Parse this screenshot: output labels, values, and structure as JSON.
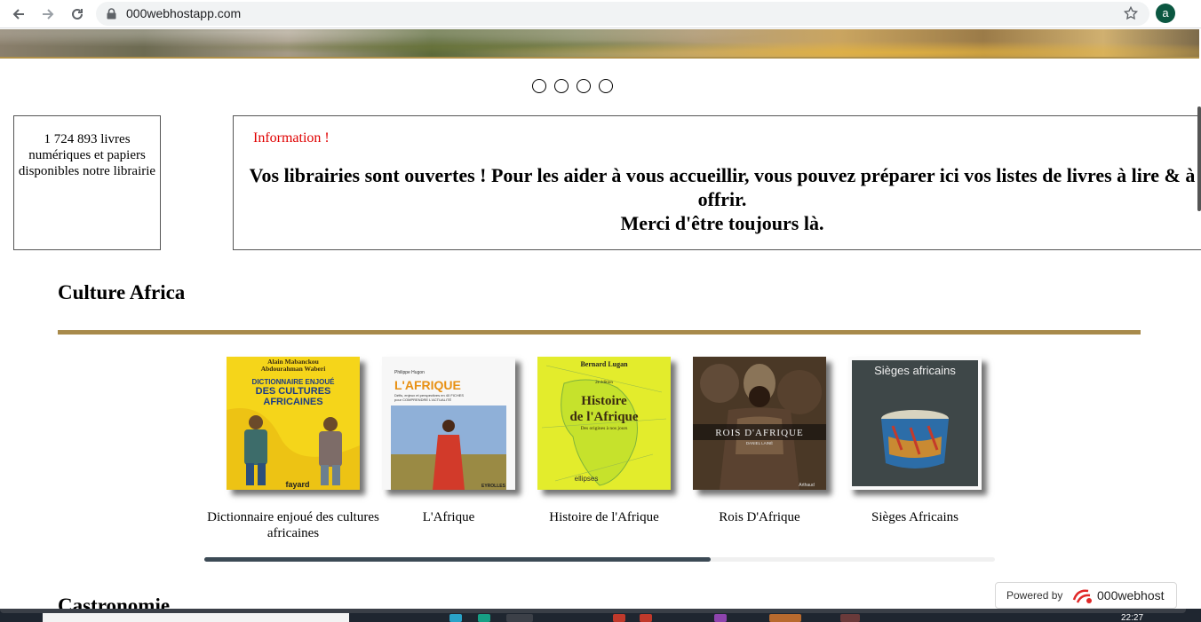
{
  "browser": {
    "url": "000webhostapp.com",
    "avatar_initial": "a",
    "avatar_color": "#0b5741"
  },
  "carousel": {
    "slide_count": 4
  },
  "stats_box": {
    "text": "1 724 893 livres numériques et papiers disponibles notre librairie"
  },
  "info_box": {
    "label": "Information !",
    "line1": "Vos librairies sont ouvertes ! Pour les aider à vous accueillir, vous pouvez préparer ici vos listes de livres à lire & à offrir.",
    "line2": "Merci d'être toujours là."
  },
  "section": {
    "title": "Culture Africa",
    "accent_color": "#a88a4b",
    "books": [
      {
        "title": "Dictionnaire enjoué des cultures africaines",
        "cover_text": {
          "authors": "Alain Mabanckou\nAbdourahman Waberi",
          "title": "DICTIONNAIRE ENJOUÉ\nDES CULTURES\nAFRICAINES",
          "publisher": "fayard"
        }
      },
      {
        "title": "L'Afrique",
        "cover_text": {
          "authors": "Philippe Hugon",
          "title": "L'AFRIQUE",
          "subtitle": "Défis, enjeux et perspectives en 40 FICHES pour COMPRENDRE L'ACTUALITÉ",
          "publisher": "EYROLLES"
        }
      },
      {
        "title": "Histoire de l'Afrique",
        "cover_text": {
          "authors": "Bernard Lugan",
          "edition": "2e édition",
          "title": "Histoire\nde l'Afrique",
          "subtitle": "Des origines à nos jours",
          "publisher": "ellipses"
        }
      },
      {
        "title": "Rois D'Afrique",
        "cover_text": {
          "title": "ROIS D'AFRIQUE",
          "authors": "DANIEL LAINÉ",
          "publisher": "Arthaud"
        }
      },
      {
        "title": "Sièges Africains",
        "cover_text": {
          "title": "Sièges africains"
        }
      }
    ],
    "scroll_fraction": 0.64
  },
  "next_section": {
    "title": "Castronomie"
  },
  "powered_by": {
    "label": "Powered by",
    "brand": "000webhost"
  },
  "taskbar": {
    "clock": "22:27"
  }
}
